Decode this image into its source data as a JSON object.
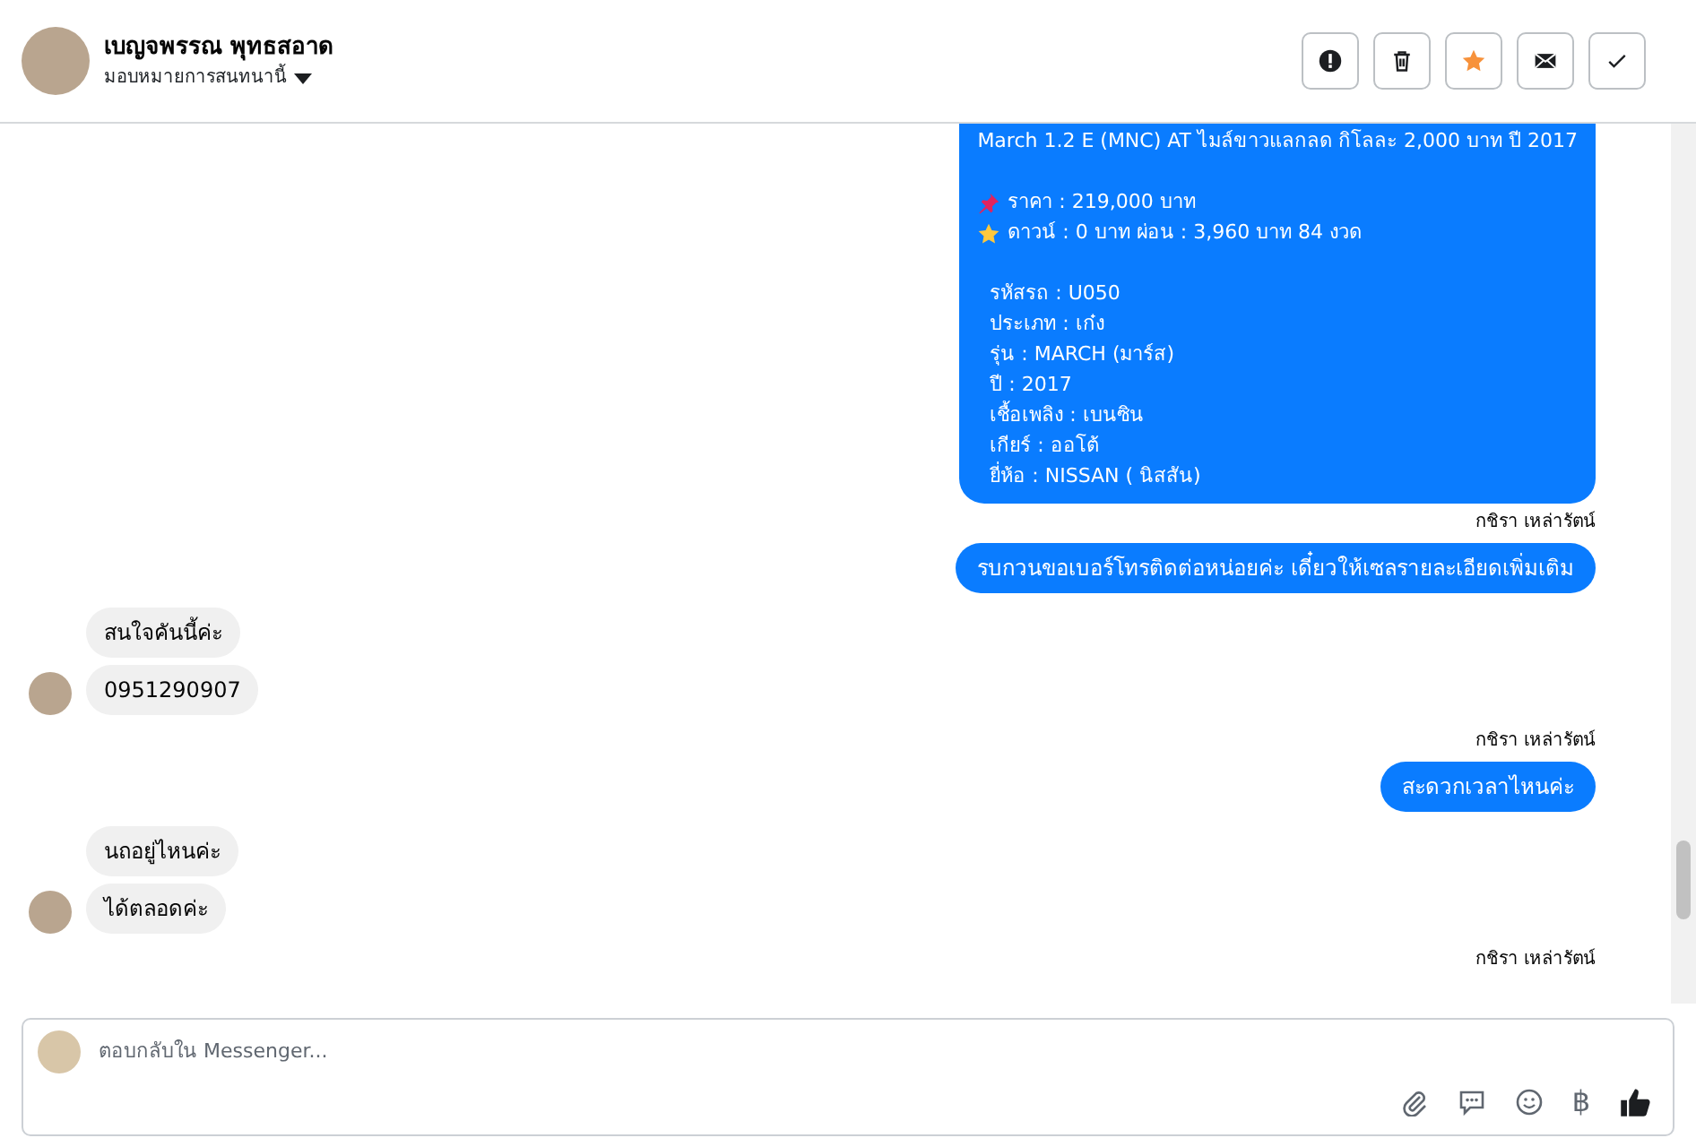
{
  "header": {
    "name": "เบญจพรรณ พุทธสอาด",
    "assign_label": "มอบหมายการสนทนานี้",
    "actions": [
      {
        "kind": "alert"
      },
      {
        "kind": "trash"
      },
      {
        "kind": "star",
        "on": true
      },
      {
        "kind": "mail"
      },
      {
        "kind": "check"
      }
    ]
  },
  "messages": [
    {
      "kind": "outgoing_card",
      "lines": [
        {
          "text": "March 1.2 E (MNC) AT ไมล์ขาวแลกลด กิโลละ 2,000 บาท ปี 2017"
        },
        {
          "kind": "blank"
        },
        {
          "kind": "pin",
          "text": "ราคา : 219,000 บาท"
        },
        {
          "kind": "star",
          "text": "ดาวน์ : 0 บาท ผ่อน : 3,960 บาท 84 งวด"
        },
        {
          "kind": "blank"
        },
        {
          "text": "  รหัสรถ : U050"
        },
        {
          "text": "  ประเภท : เก๋ง"
        },
        {
          "text": "  รุ่น : MARCH (มาร์ส)"
        },
        {
          "text": "  ปี : 2017"
        },
        {
          "text": "  เชื้อเพลิง : เบนซิน"
        },
        {
          "text": "  เกียร์ : ออโต้"
        },
        {
          "text": "  ยี่ห้อ : NISSAN ( นิสสัน)"
        }
      ]
    },
    {
      "kind": "sender",
      "text": "กชิรา เหล่ารัตน์"
    },
    {
      "kind": "outgoing",
      "text": "รบกวนขอเบอร์โทรติดต่อหน่อยค่ะ เดี๋ยวให้เซลรายละเอียดเพิ่มเติม"
    },
    {
      "kind": "incoming",
      "texts": [
        "สนใจคันนี้ค่ะ",
        "0951290907"
      ]
    },
    {
      "kind": "sender",
      "text": "กชิรา เหล่ารัตน์"
    },
    {
      "kind": "outgoing",
      "text": "สะดวกเวลาไหนค่ะ"
    },
    {
      "kind": "incoming",
      "texts": [
        "นถอยู่ไหนค่ะ",
        "ได้ตลอดค่ะ"
      ]
    },
    {
      "kind": "sender",
      "text": "กชิรา เหล่ารัตน์"
    }
  ],
  "composer": {
    "placeholder": "ตอบกลับใน Messenger...",
    "tools": [
      {
        "kind": "attach"
      },
      {
        "kind": "chat"
      },
      {
        "kind": "emoji"
      },
      {
        "kind": "baht",
        "text": "฿"
      },
      {
        "kind": "like"
      }
    ]
  }
}
